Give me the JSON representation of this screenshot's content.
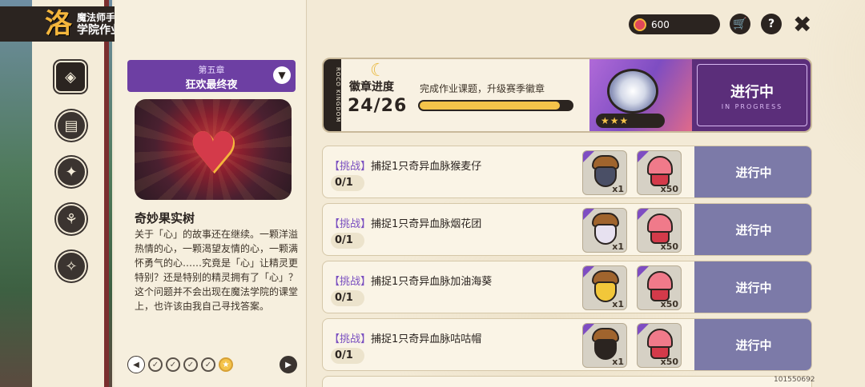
{
  "header": {
    "title_top": "魔法师手册",
    "title_main": "学院作业",
    "logo_glyph": "洛"
  },
  "side_nav": [
    {
      "icon": "compass-icon",
      "glyph": "◈",
      "active": true
    },
    {
      "icon": "book-icon",
      "glyph": "▤",
      "active": false
    },
    {
      "icon": "star-bubble-icon",
      "glyph": "✦",
      "active": false
    },
    {
      "icon": "molecule-icon",
      "glyph": "⚘",
      "active": false
    },
    {
      "icon": "star-card-icon",
      "glyph": "✧",
      "active": false
    }
  ],
  "chapter": {
    "number": "第五章",
    "name": "狂欢最终夜"
  },
  "item": {
    "title": "奇妙果实树",
    "description": "关于「心」的故事还在继续。一颗洋溢热情的心，一颗渴望友情的心，一颗满怀勇气的心……究竟是「心」让精灵更特别？还是特别的精灵拥有了「心」？这个问题并不会出现在魔法学院的课堂上，也许该由我自己寻找答案。"
  },
  "pager": {
    "prev_glyph": "◀",
    "next_glyph": "▶",
    "dots": [
      {
        "icon": "gear-check-icon",
        "glyph": "✓",
        "current": false
      },
      {
        "icon": "check-icon",
        "glyph": "✓",
        "current": false
      },
      {
        "icon": "check-icon",
        "glyph": "✓",
        "current": false
      },
      {
        "icon": "check-icon",
        "glyph": "✓",
        "current": false
      },
      {
        "icon": "star-icon",
        "glyph": "★",
        "current": true
      }
    ]
  },
  "topbar": {
    "currency_amount": "600",
    "cart_glyph": "🛒",
    "help_glyph": "?",
    "close_glyph": "✖"
  },
  "badge": {
    "label": "徽章进度",
    "count": "24/26",
    "progress": 0.9231,
    "tip": "完成作业课题，升级赛季徽章",
    "stars": "★★★",
    "status": "进行中",
    "status_sub": "IN PROGRESS",
    "side_label": "ROCO KINGDOM"
  },
  "tasks": [
    {
      "tag": "【挑战】",
      "text": "捕捉1只奇异血脉猴麦仔",
      "progress": "0/1",
      "reward1_qty": "x1",
      "reward2_qty": "x50",
      "status": "进行中"
    },
    {
      "tag": "【挑战】",
      "text": "捕捉1只奇异血脉烟花团",
      "progress": "0/1",
      "reward1_qty": "x1",
      "reward2_qty": "x50",
      "status": "进行中"
    },
    {
      "tag": "【挑战】",
      "text": "捕捉1只奇异血脉加油海葵",
      "progress": "0/1",
      "reward1_qty": "x1",
      "reward2_qty": "x50",
      "status": "进行中"
    },
    {
      "tag": "【挑战】",
      "text": "捕捉1只奇异血脉咕咕帽",
      "progress": "0/1",
      "reward1_qty": "x1",
      "reward2_qty": "x50",
      "status": "进行中"
    }
  ],
  "footer": {
    "uid": "101550692"
  }
}
